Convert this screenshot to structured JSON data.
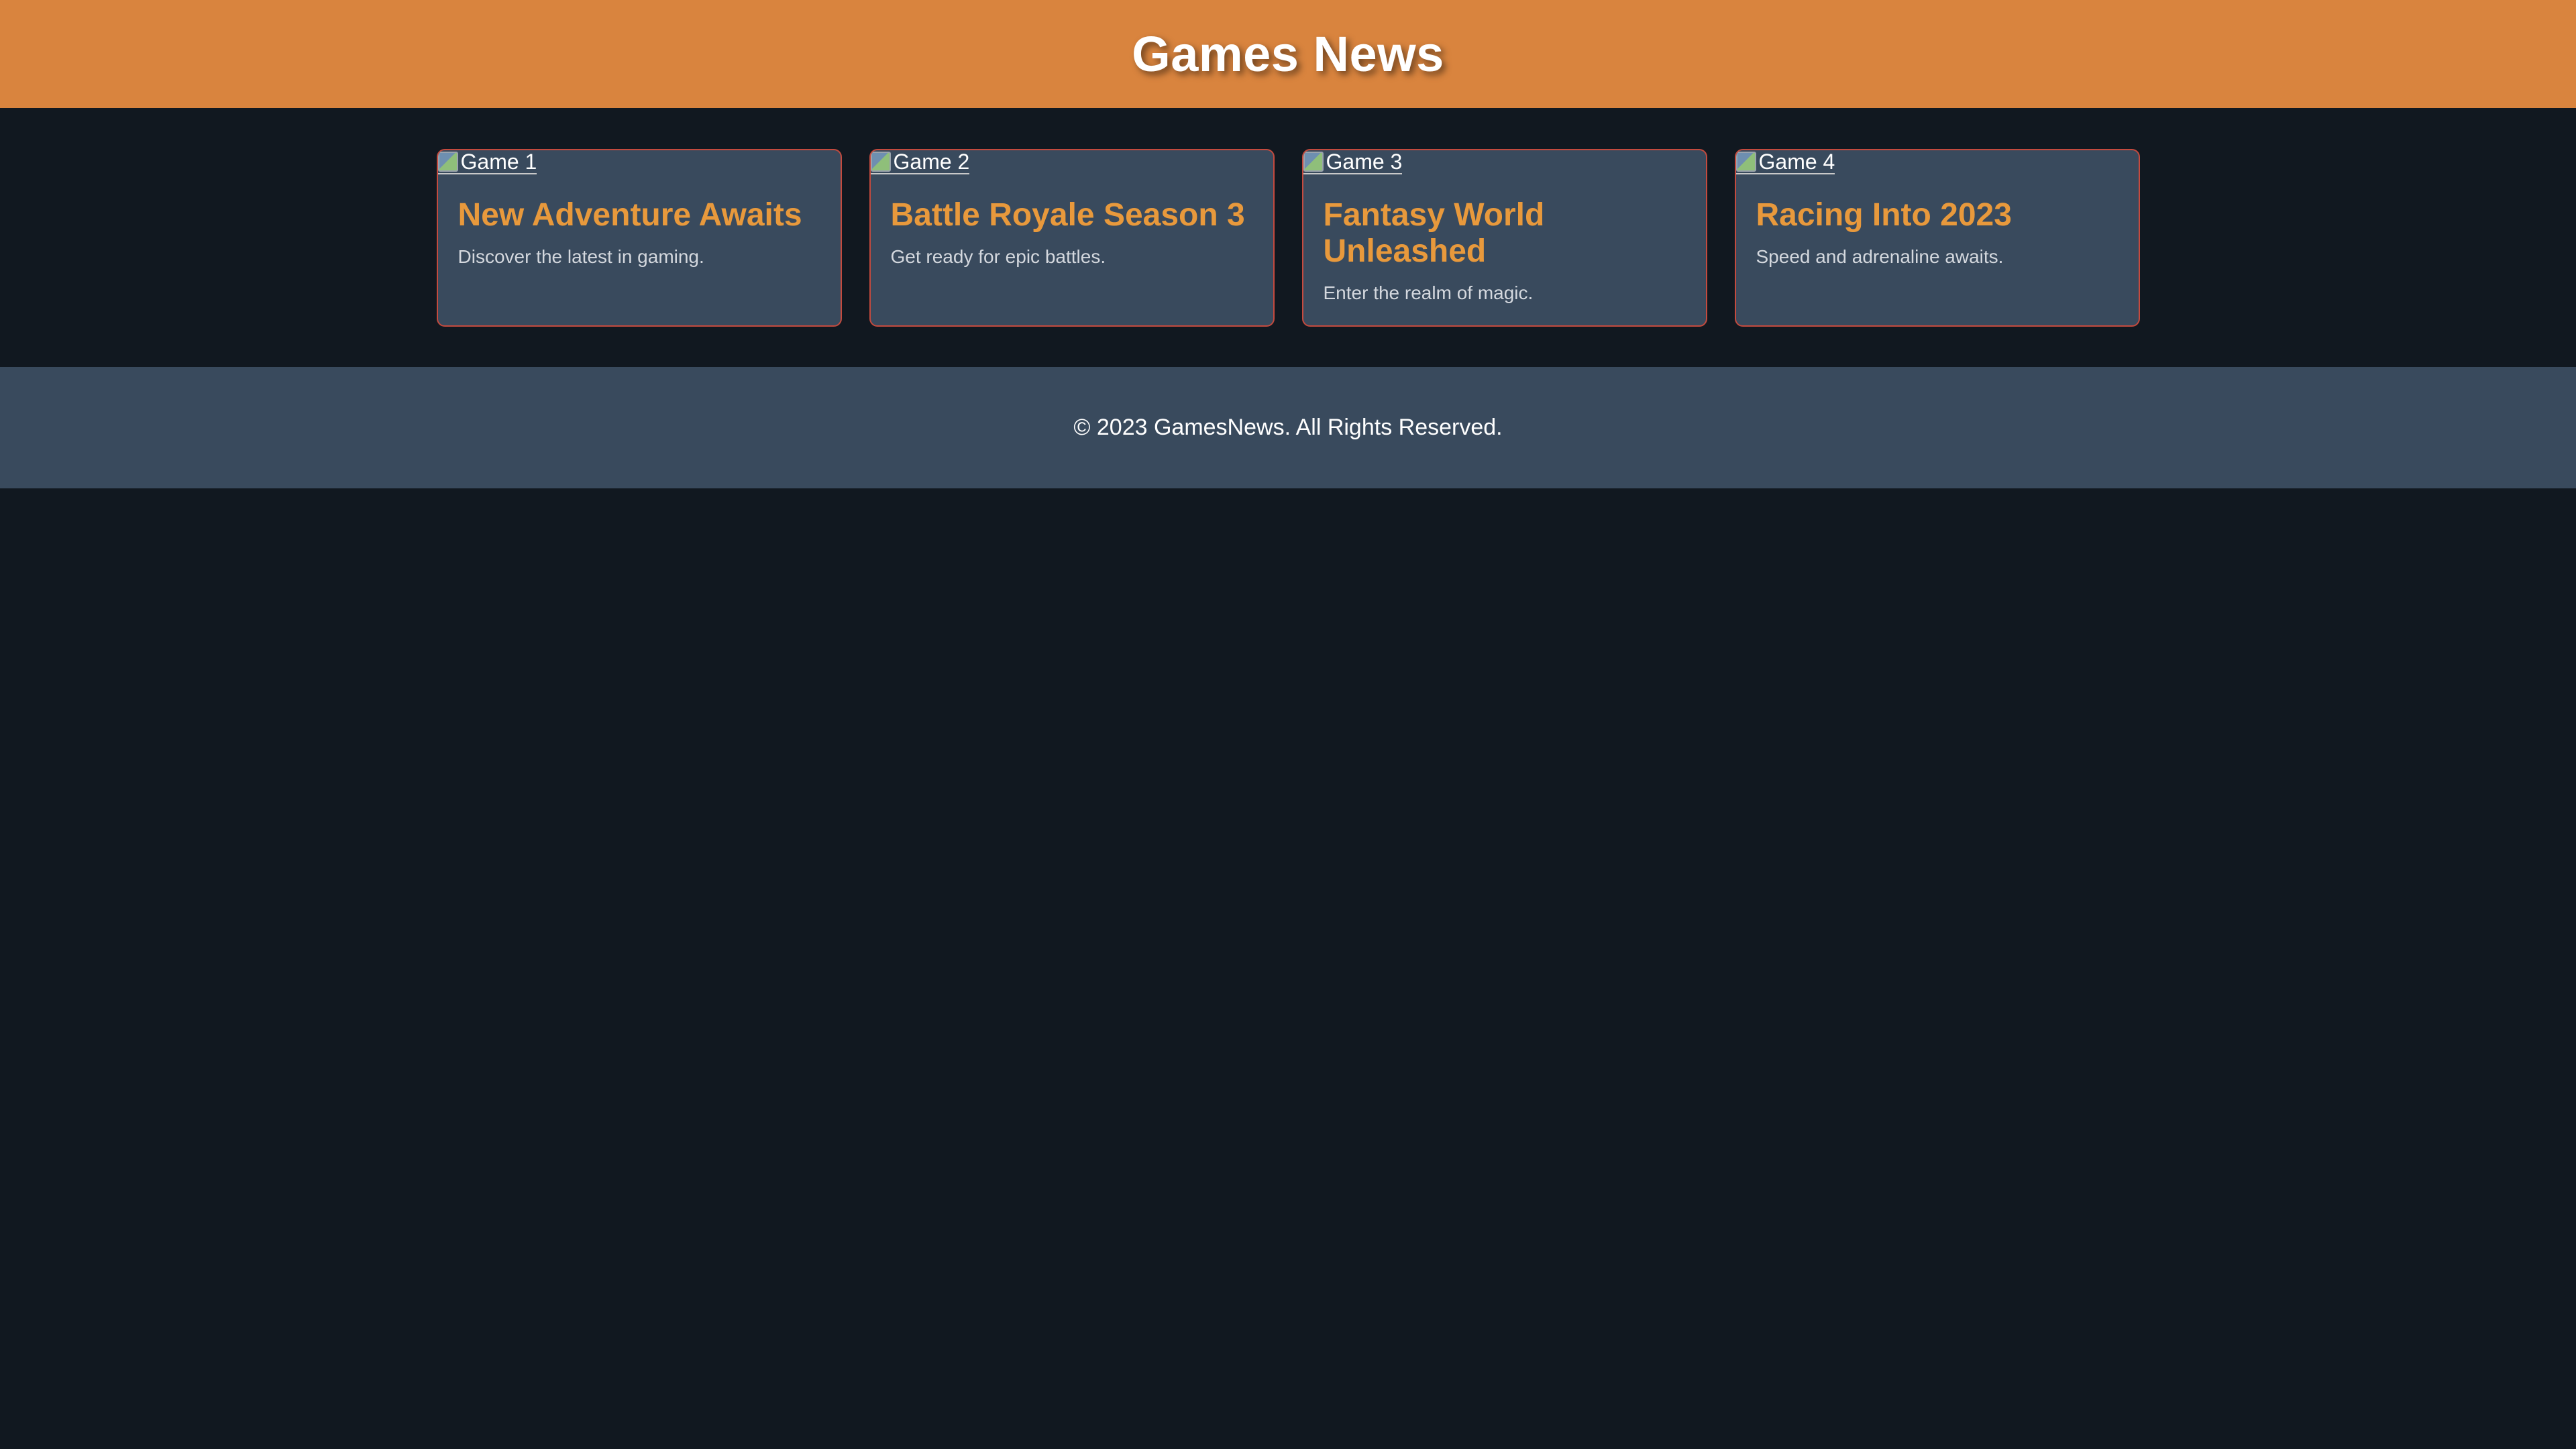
{
  "header": {
    "title": "Games News"
  },
  "articles": [
    {
      "image_alt": "Game 1",
      "title": "New Adventure Awaits",
      "description": "Discover the latest in gaming."
    },
    {
      "image_alt": "Game 2",
      "title": "Battle Royale Season 3",
      "description": "Get ready for epic battles."
    },
    {
      "image_alt": "Game 3",
      "title": "Fantasy World Unleashed",
      "description": "Enter the realm of magic."
    },
    {
      "image_alt": "Game 4",
      "title": "Racing Into 2023",
      "description": "Speed and adrenaline awaits."
    }
  ],
  "footer": {
    "text": "© 2023 GamesNews. All Rights Reserved."
  },
  "colors": {
    "header_bg": "#d9843e",
    "page_bg": "#111820",
    "card_bg": "#394a5d",
    "card_border": "#c44a3e",
    "card_title": "#e8993c",
    "footer_bg": "#394a5d"
  },
  "icons": {
    "image_placeholder": "broken-image-icon"
  }
}
